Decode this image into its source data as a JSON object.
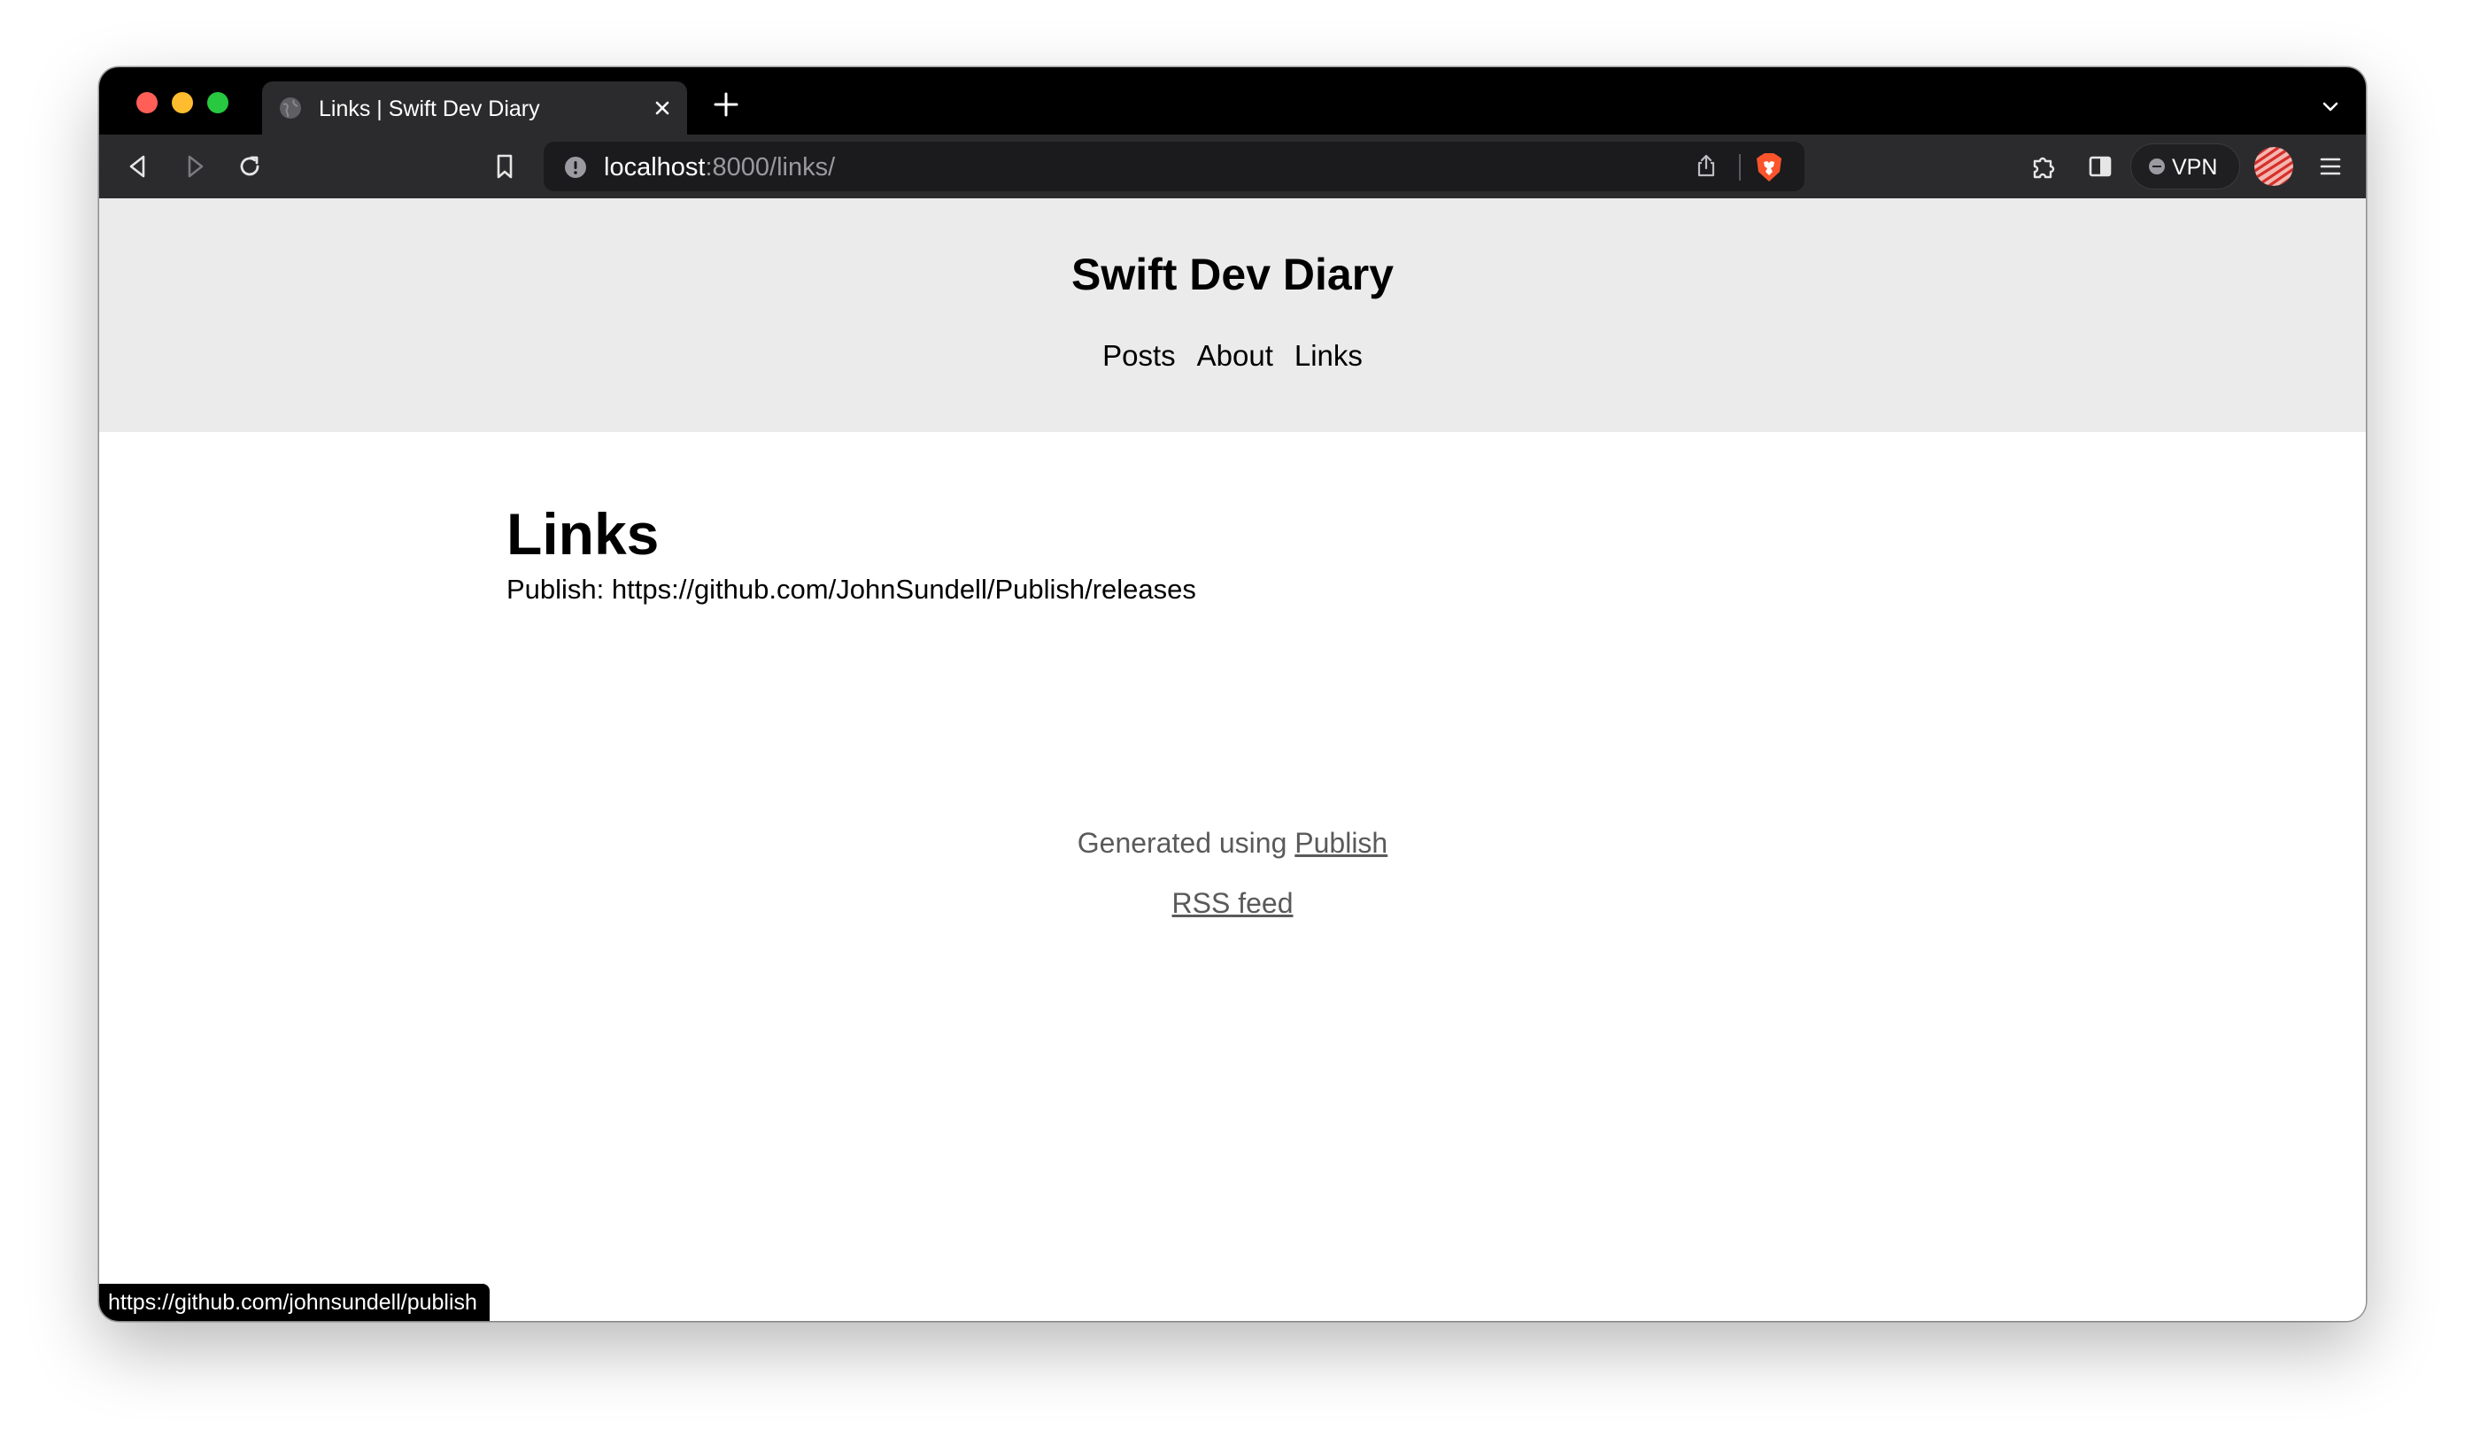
{
  "browser": {
    "tab": {
      "title": "Links | Swift Dev Diary"
    },
    "url": {
      "host": "localhost",
      "path": ":8000/links/"
    },
    "vpn_label": "VPN",
    "status_url": "https://github.com/johnsundell/publish"
  },
  "site": {
    "title": "Swift Dev Diary",
    "nav": [
      "Posts",
      "About",
      "Links"
    ]
  },
  "main": {
    "heading": "Links",
    "entry": "Publish: https://github.com/JohnSundell/Publish/releases"
  },
  "footer": {
    "generated_prefix": "Generated using ",
    "generated_link": "Publish",
    "rss_link": "RSS feed"
  },
  "colors": {
    "header_bg": "#ebebeb",
    "chrome_bg": "#2b2b2d",
    "tabstrip_bg": "#000000",
    "footer_text": "#5a5a5a",
    "brave_orange": "#fb542b"
  }
}
